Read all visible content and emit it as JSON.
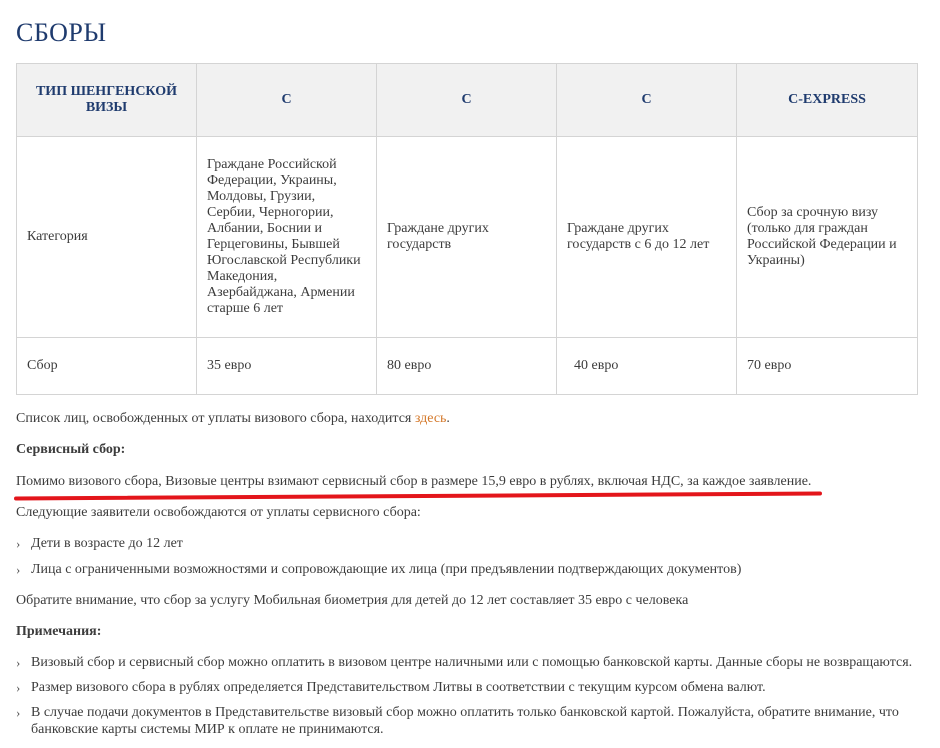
{
  "title": "СБОРЫ",
  "table": {
    "headers": [
      "ТИП ШЕНГЕНСКОЙ ВИЗЫ",
      "C",
      "C",
      "C",
      "C-EXPRESS"
    ],
    "category_row": [
      "Категория",
      "Граждане Российской Федерации, Украины, Молдовы, Грузии, Сербии, Черногории, Албании, Боснии и Герцеговины, Бывшей Югославской Республики Македония, Азербайджана, Армении старше 6 лет",
      "Граждане других государств",
      "Граждане других государств с 6 до 12 лет",
      "Сбор за срочную визу (только для граждан Российской Федерации и Украины)"
    ],
    "fee_row": [
      "Сбор",
      "35 евро",
      "80 евро",
      "40 евро",
      "70 евро"
    ]
  },
  "exempt_text": "Список лиц, освобожденных от уплаты визового сбора, находится ",
  "exempt_link": "здесь",
  "exempt_end": ".",
  "service_heading": "Сервисный сбор:",
  "service_text": "Помимо визового сбора, Визовые центры взимают сервисный сбор в размере 15,9 евро в рублях, включая НДС, за каждое заявление.",
  "service_exempt_intro": "Следующие заявители освобождаются от уплаты сервисного сбора:",
  "service_exempt_items": [
    "Дети в возрасте до 12 лет",
    "Лица с ограниченными возможностями и сопровождающие их лица (при предъявлении подтверждающих документов)"
  ],
  "biometrics_note": "Обратите внимание, что сбор за услугу Мобильная биометрия для детей до 12 лет составляет 35 евро с человека",
  "notes_heading": "Примечания:",
  "notes_items": [
    "Визовый сбор и сервисный сбор можно оплатить в визовом центре наличными или с помощью банковской карты. Данные сборы не возвращаются.",
    "Размер визового сбора в рублях определяется Представительством Литвы в соответствии с текущим курсом обмена валют.",
    "В случае подачи документов в Представительстве визовый сбор можно оплатить только банковской картой. Пожалуйста, обратите внимание, что банковские карты системы МИР к оплате не принимаются."
  ],
  "bullet_glyph": "›",
  "colors": {
    "title": "#1f3b6e",
    "link": "#d4782a",
    "highlight_line": "#e3151b",
    "header_bg": "#f1f1f1"
  }
}
